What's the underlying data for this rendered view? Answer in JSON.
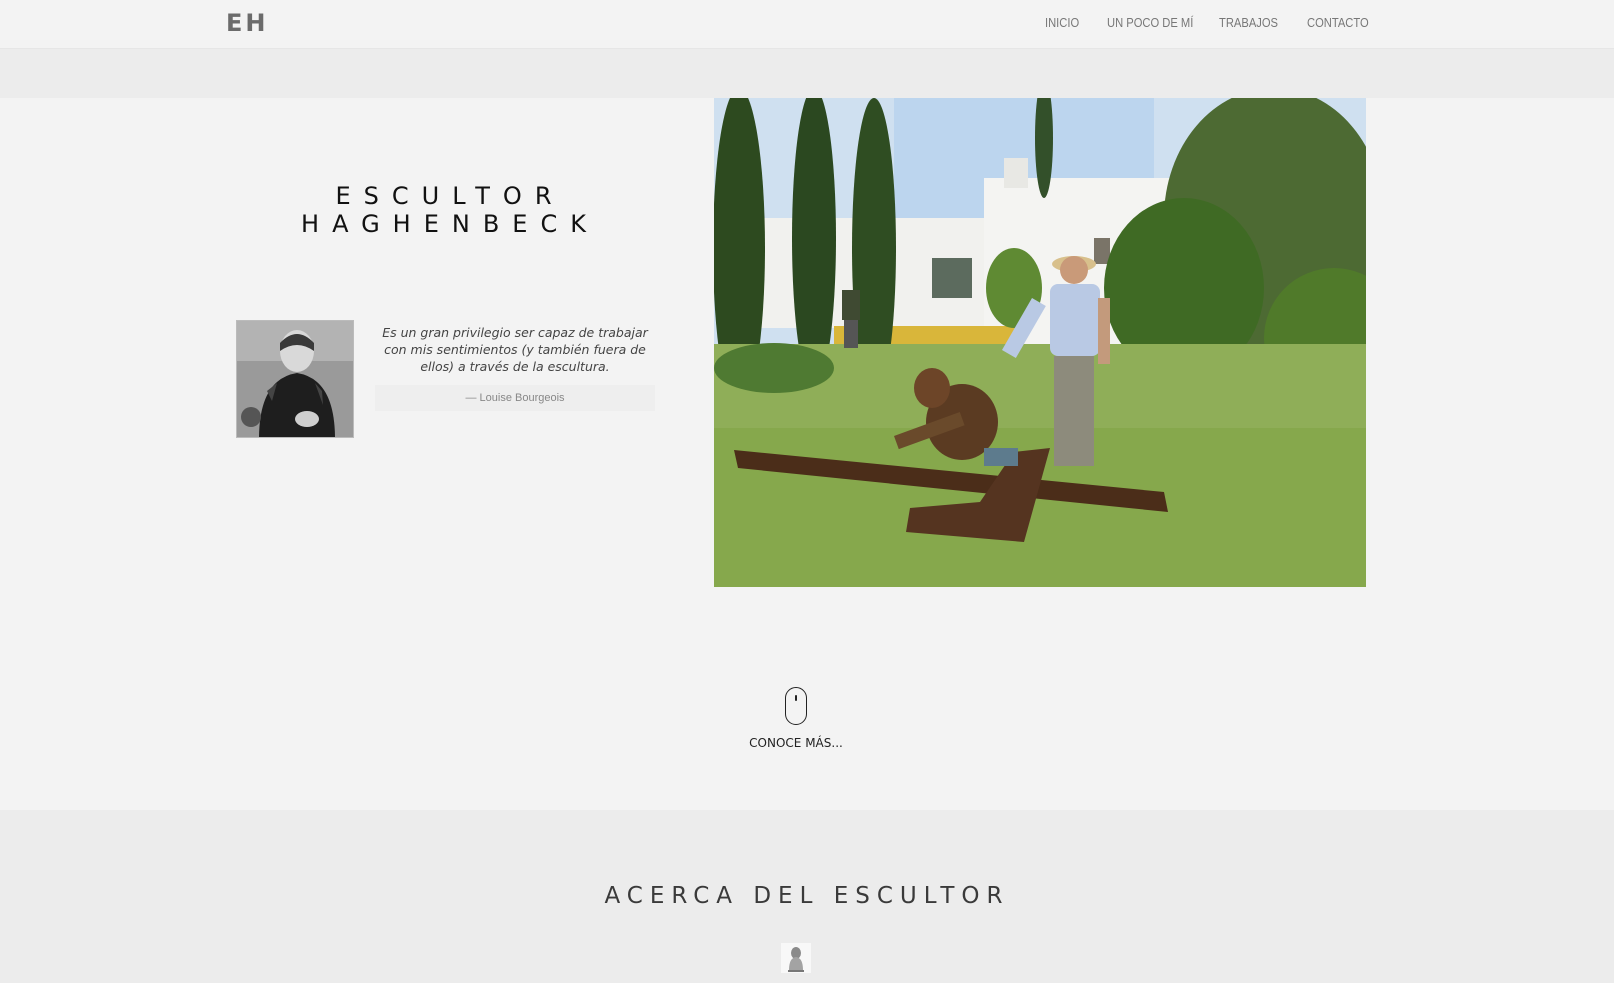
{
  "header": {
    "brand": "EH",
    "nav": [
      {
        "label": "INICIO"
      },
      {
        "label": "UN POCO DE MÍ"
      },
      {
        "label": "TRABAJOS"
      },
      {
        "label": "CONTACTO"
      }
    ]
  },
  "hero": {
    "title_line1": "ESCULTOR",
    "title_line2": "HAGHENBECK",
    "quote": "Es un gran privilegio ser capaz de trabajar con mis sentimientos (y también fuera de ellos) a través de la escultura.",
    "quote_author": "— Louise Bourgeois"
  },
  "scroll": {
    "label": "CONOCE MÁS..."
  },
  "about": {
    "title": "ACERCA DEL ESCULTOR"
  },
  "icons": {
    "scroll": "mouse-icon",
    "about": "sculpture-icon"
  },
  "colors": {
    "background": "#f3f3f3",
    "section_alt": "#ececec",
    "nav_text": "#777777"
  }
}
